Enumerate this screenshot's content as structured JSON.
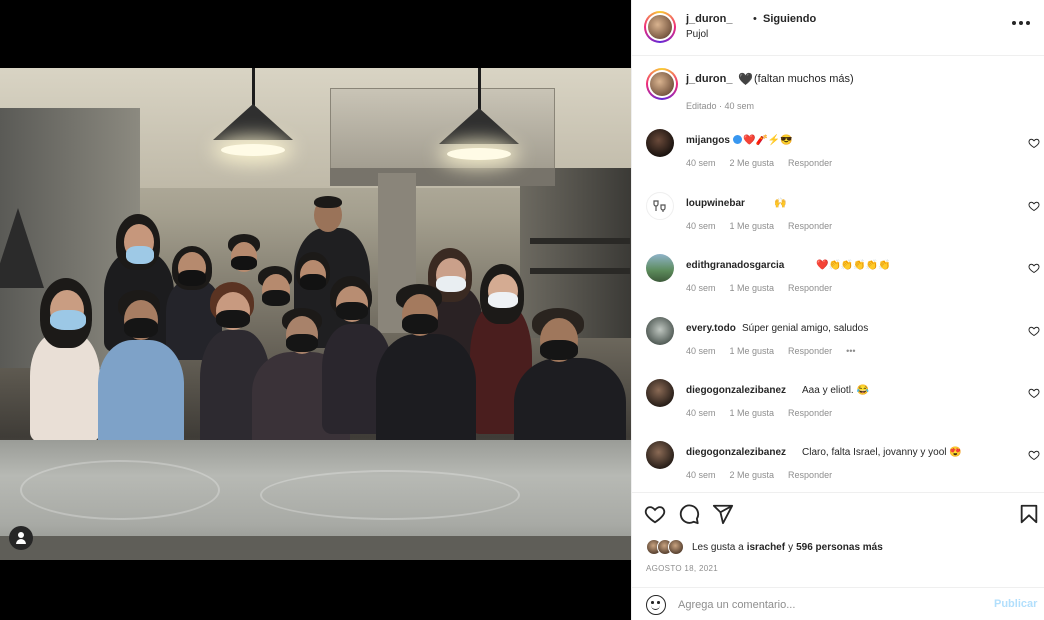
{
  "post": {
    "username": "j_duron_",
    "dot": "•",
    "follow_label": "Siguiendo",
    "location": "Pujol",
    "more_icon": "more-horizontal-icon"
  },
  "caption": {
    "username": "j_duron_",
    "emoji": "🖤",
    "text": "(faltan muchos más)",
    "meta": "Editado · 40 sem"
  },
  "comments": [
    {
      "user": "mijangos",
      "verified": true,
      "text": "❤️🧨⚡😎",
      "time": "40 sem",
      "likes": "2 Me gusta",
      "reply": "Responder"
    },
    {
      "user": "loupwinebar",
      "verified": false,
      "text": "🙌",
      "time": "40 sem",
      "likes": "1 Me gusta",
      "reply": "Responder"
    },
    {
      "user": "edithgranadosgarcia",
      "verified": false,
      "text": "❤️👏👏👏👏👏",
      "time": "40 sem",
      "likes": "1 Me gusta",
      "reply": "Responder"
    },
    {
      "user": "every.todo",
      "verified": false,
      "text": "Súper genial amigo, saludos",
      "time": "40 sem",
      "likes": "1 Me gusta",
      "reply": "Responder",
      "more": "•••"
    },
    {
      "user": "diegogonzalezibanez",
      "verified": false,
      "text": "Aaa y eliotl. 😂",
      "time": "40 sem",
      "likes": "1 Me gusta",
      "reply": "Responder"
    },
    {
      "user": "diegogonzalezibanez",
      "verified": false,
      "text": "Claro, falta Israel, jovanny y yool 😍",
      "time": "40 sem",
      "likes": "2 Me gusta",
      "reply": "Responder"
    }
  ],
  "actions": {
    "like_icon": "heart-icon",
    "comment_icon": "comment-bubble-icon",
    "share_icon": "paper-plane-icon",
    "save_icon": "bookmark-icon"
  },
  "likes": {
    "prefix": "Les gusta a",
    "user": "israchef",
    "conj": "y",
    "others": "596 personas más"
  },
  "date": "AGOSTO 18, 2021",
  "add_comment": {
    "placeholder": "Agrega un comentario...",
    "publish_label": "Publicar"
  },
  "colors": {
    "text": "#262626",
    "muted": "#8e8e8e",
    "link_disabled": "#b2dffc",
    "verified": "#3897f0",
    "heart_red": "#ed4956"
  }
}
